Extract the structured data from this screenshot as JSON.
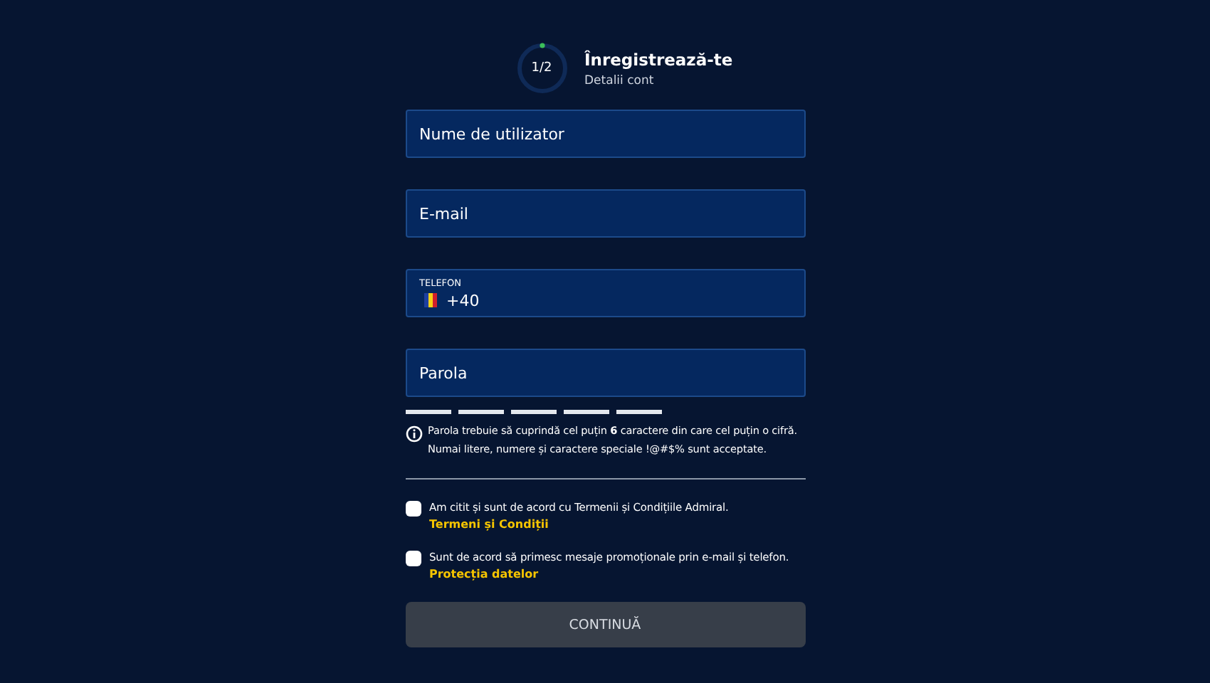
{
  "header": {
    "step": "1/2",
    "title": "Înregistrează-te",
    "subtitle": "Detalii cont"
  },
  "fields": [
    {
      "kind": "text",
      "placeholder": "Nume de utilizator"
    },
    {
      "kind": "text",
      "placeholder": "E-mail"
    },
    {
      "kind": "phone",
      "label": "TELEFON",
      "value": "+40"
    },
    {
      "kind": "text",
      "placeholder": "Parola"
    }
  ],
  "hint": "Parola trebuie să cuprindă cel puțin **6** caractere din care cel puțin o cifră. Numai litere, numere și caractere speciale !@#$% sunt acceptate.",
  "consents": [
    {
      "text": "Am citit și sunt de acord cu Termenii și Condițiile Admiral.",
      "link": "Termeni și Condiții",
      "checked": false
    },
    {
      "text": "Sunt de acord să primesc mesaje promoționale prin e-mail și telefon.",
      "link": "Protecția datelor",
      "checked": false
    }
  ],
  "button": {
    "label": "CONTINUĂ",
    "disabled": true
  }
}
